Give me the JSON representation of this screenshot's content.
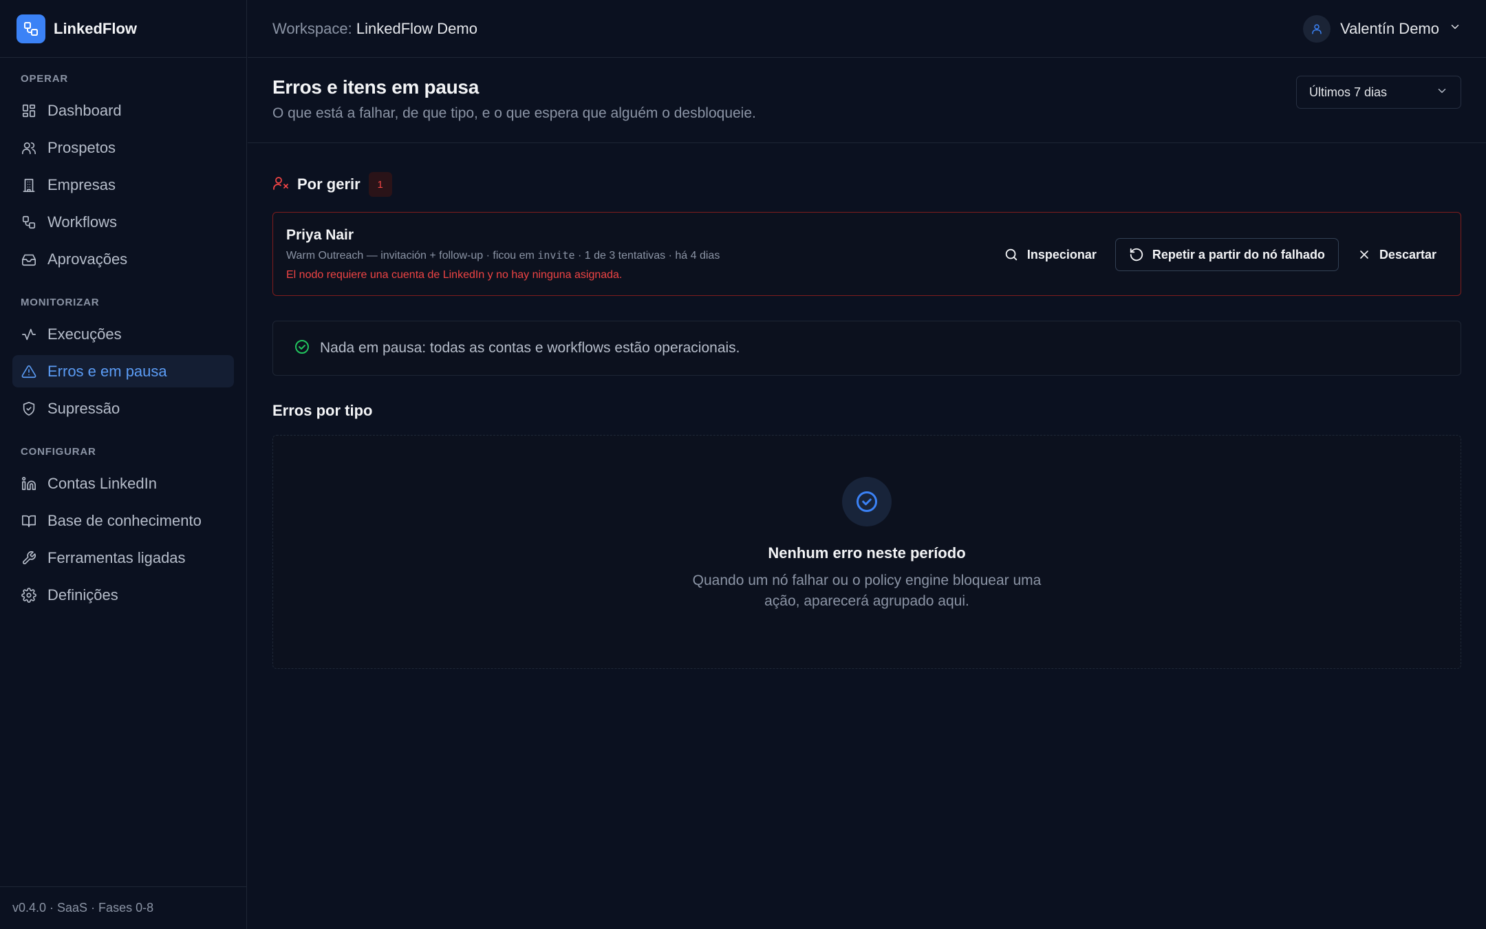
{
  "app": {
    "name": "LinkedFlow"
  },
  "sidebar": {
    "sections": [
      {
        "heading": "OPERAR",
        "items": [
          {
            "label": "Dashboard",
            "icon": "dashboard-grid-icon"
          },
          {
            "label": "Prospetos",
            "icon": "users-icon"
          },
          {
            "label": "Empresas",
            "icon": "building-icon"
          },
          {
            "label": "Workflows",
            "icon": "workflow-icon"
          },
          {
            "label": "Aprovações",
            "icon": "inbox-icon"
          }
        ]
      },
      {
        "heading": "MONITORIZAR",
        "items": [
          {
            "label": "Execuções",
            "icon": "activity-icon"
          },
          {
            "label": "Erros e em pausa",
            "icon": "alert-triangle-icon",
            "active": true
          },
          {
            "label": "Supressão",
            "icon": "shield-check-icon"
          }
        ]
      },
      {
        "heading": "CONFIGURAR",
        "items": [
          {
            "label": "Contas LinkedIn",
            "icon": "linkedin-icon"
          },
          {
            "label": "Base de conhecimento",
            "icon": "book-icon"
          },
          {
            "label": "Ferramentas ligadas",
            "icon": "wrench-icon"
          },
          {
            "label": "Definições",
            "icon": "gear-icon"
          }
        ]
      }
    ],
    "footer": "v0.4.0 · SaaS · Fases 0-8"
  },
  "topbar": {
    "workspace_label": "Workspace:",
    "workspace_name": "LinkedFlow Demo",
    "user_name": "Valentín Demo"
  },
  "header": {
    "title": "Erros e itens em pausa",
    "subtitle": "O que está a falhar, de que tipo, e o que espera que alguém o desbloqueie.",
    "range": "Últimos 7 dias"
  },
  "pending": {
    "title": "Por gerir",
    "count": "1",
    "items": [
      {
        "name": "Priya Nair",
        "meta_before": "Warm Outreach — invitación + follow-up · ficou em",
        "meta_node": "invite",
        "meta_after": "· 1 de 3 tentativas · há 4 dias",
        "error": "El nodo requiere una cuenta de LinkedIn y no hay ninguna asignada."
      }
    ],
    "actions": {
      "inspect": "Inspecionar",
      "retry": "Repetir a partir do nó falhado",
      "dismiss": "Descartar"
    }
  },
  "paused": {
    "message": "Nada em pausa: todas as contas e workflows estão operacionais."
  },
  "errors_by_type": {
    "title": "Erros por tipo",
    "empty_title": "Nenhum erro neste período",
    "empty_desc": "Quando um nó falhar ou o policy engine bloquear uma ação, aparecerá agrupado aqui."
  },
  "colors": {
    "accent": "#3b82f6",
    "danger": "#ef4444",
    "success": "#22c55e",
    "background": "#0b1120"
  }
}
